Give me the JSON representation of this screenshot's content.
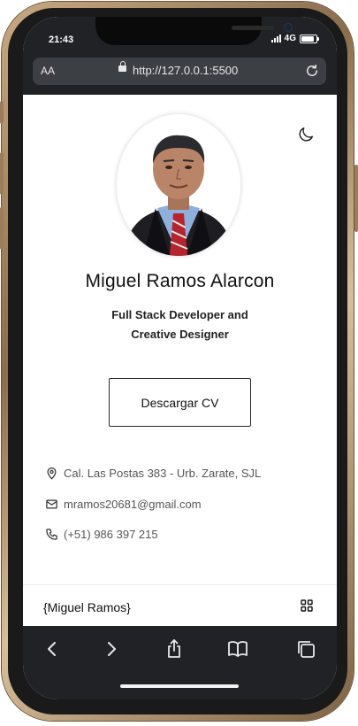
{
  "status_bar": {
    "time": "21:43",
    "network": "4G"
  },
  "browser": {
    "text_size_label": "AA",
    "url": "http://127.0.0.1:5500"
  },
  "profile": {
    "name": "Miguel Ramos Alarcon",
    "role_line1": "Full Stack Developer and",
    "role_line2": "Creative Designer",
    "cv_button": "Descargar CV"
  },
  "contact": {
    "address": "Cal. Las Postas 383 - Urb. Zarate, SJL",
    "email": "mramos20681@gmail.com",
    "phone": "(+51) 986 397 215"
  },
  "footer": {
    "brand": "{Miguel Ramos}"
  },
  "icons": {
    "theme": "moon-icon",
    "address": "map-pin-icon",
    "email": "mail-icon",
    "phone": "phone-icon",
    "menu": "grid-icon",
    "toolbar": [
      "back-icon",
      "forward-icon",
      "share-icon",
      "bookmarks-icon",
      "tabs-icon"
    ]
  },
  "colors": {
    "frame": "#b8976f",
    "browser_chrome": "#202225",
    "text": "#111111",
    "muted": "#555555"
  }
}
